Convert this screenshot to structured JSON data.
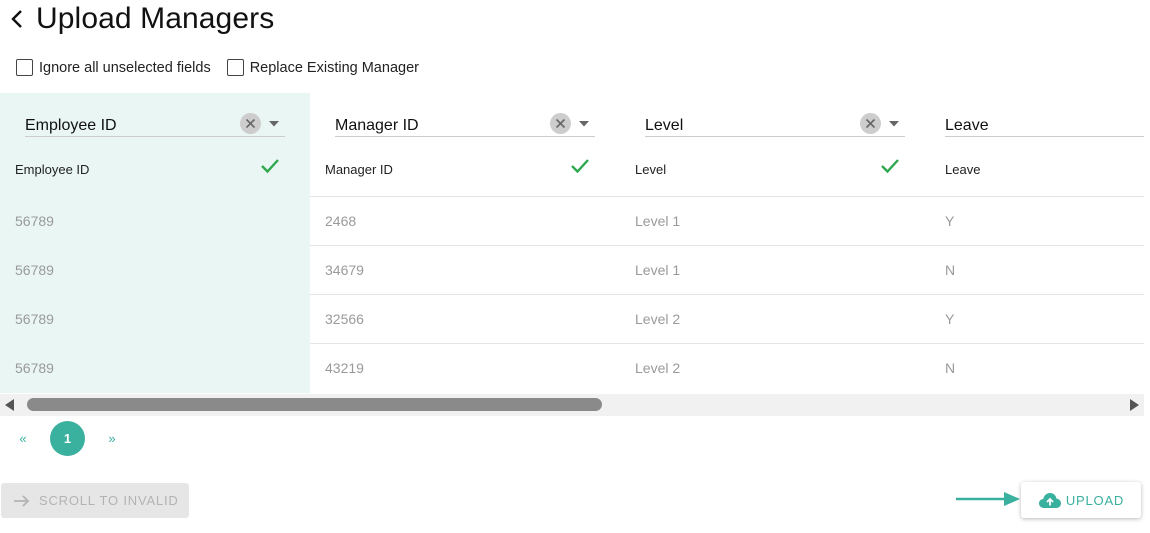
{
  "header": {
    "title": "Upload Managers"
  },
  "options": {
    "ignore_unselected": {
      "label": "Ignore all unselected fields",
      "checked": false
    },
    "replace_existing": {
      "label": "Replace Existing Manager",
      "checked": false
    }
  },
  "columns": [
    {
      "selected_field": "Employee ID",
      "source_header": "Employee ID",
      "matched": true,
      "cells": [
        "56789",
        "56789",
        "56789",
        "56789"
      ]
    },
    {
      "selected_field": "Manager ID",
      "source_header": "Manager ID",
      "matched": true,
      "cells": [
        "2468",
        "34679",
        "32566",
        "43219"
      ]
    },
    {
      "selected_field": "Level",
      "source_header": "Level",
      "matched": true,
      "cells": [
        "Level 1",
        "Level 1",
        "Level 2",
        "Level 2"
      ]
    },
    {
      "selected_field": "Leave",
      "source_header": "Leave",
      "matched": false,
      "cells": [
        "Y",
        "N",
        "Y",
        "N"
      ]
    }
  ],
  "pagination": {
    "prev": "«",
    "current": "1",
    "next": "»"
  },
  "actions": {
    "scroll_to_invalid": "SCROLL TO INVALID",
    "upload": "UPLOAD"
  },
  "colors": {
    "accent": "#3ab09e",
    "check": "#2fa84f",
    "selected_column_bg": "#e9f6f4"
  },
  "icons": [
    "chevron-left-icon",
    "clear-icon",
    "caret-down-icon",
    "check-icon",
    "arrow-right-icon",
    "cloud-upload-icon"
  ]
}
